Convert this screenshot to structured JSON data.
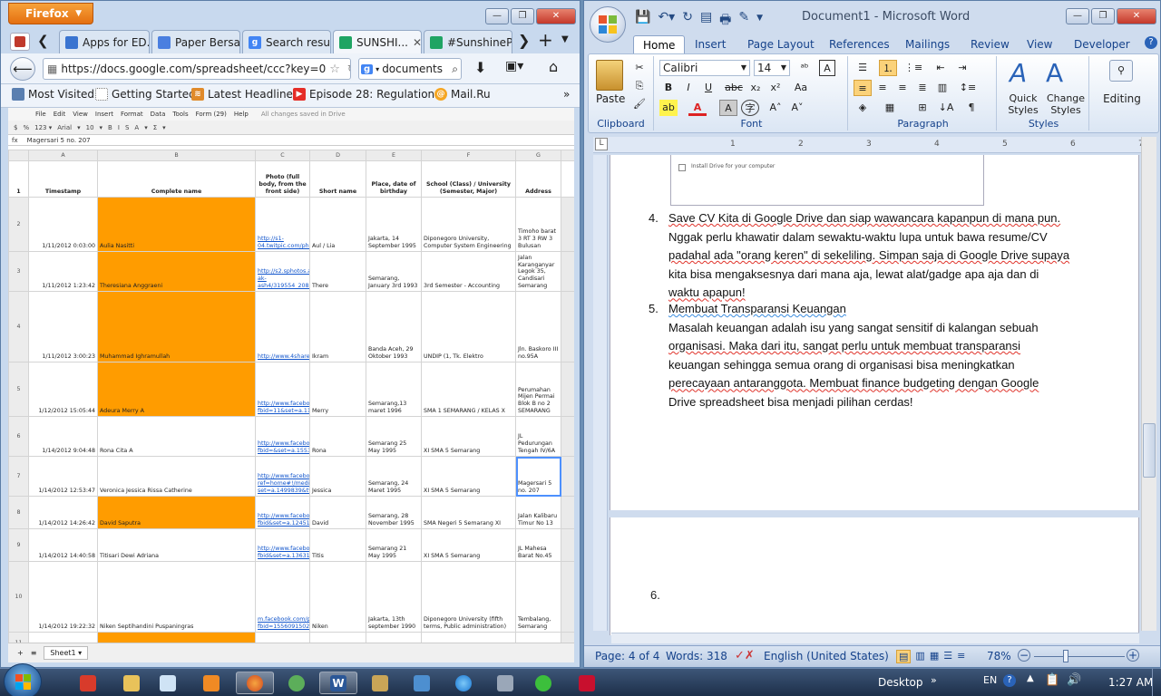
{
  "firefox": {
    "menu_button": "Firefox",
    "tabs": [
      {
        "label": "Apps for ED...",
        "icon": "doc-icon",
        "color": "#3a74d0"
      },
      {
        "label": "Paper Bersa...",
        "icon": "docs-icon",
        "color": "#4a7fe0"
      },
      {
        "label": "Search resul...",
        "icon": "google-icon",
        "color": "#4285f4"
      },
      {
        "label": "SUNSHI...",
        "icon": "drive-icon",
        "color": "#1fa463",
        "active": true
      },
      {
        "label": "#SunshineP...",
        "icon": "drive-icon",
        "color": "#1fa463"
      }
    ],
    "url": "https://docs.google.com/spreadsheet/ccc?key=0",
    "search_value": "documents",
    "bookmarks": [
      "Most Visited",
      "Getting Started",
      "Latest Headlines",
      "Episode 28: Regulation...",
      "Mail.Ru"
    ]
  },
  "sheet": {
    "menu": [
      "File",
      "Edit",
      "View",
      "Insert",
      "Format",
      "Data",
      "Tools",
      "Form (29)",
      "Help",
      "All changes saved in Drive"
    ],
    "toolbar": [
      "$",
      "%",
      "123 ▾",
      "Arial",
      "▾",
      "10",
      "▾",
      "B",
      "I",
      "S",
      "A",
      "▾",
      "Σ",
      "▾"
    ],
    "formula_label": "fx",
    "formula_value": "Magersari 5 no. 207",
    "columns": [
      "A",
      "B",
      "C",
      "D",
      "E",
      "F",
      "G"
    ],
    "headers": [
      "Timestamp",
      "Complete name",
      "Photo (full body, from the front side)",
      "Short name",
      "Place, date of birthday",
      "School (Class) / University (Semester, Major)",
      "Address"
    ],
    "rows": [
      {
        "n": "2",
        "ts": "1/11/2012 0:03:00",
        "name": "Aulia Nasitti",
        "photo": "http://s1-04.twitpic.com/photos/full/493254695.jpg",
        "short": "Aul / Lia",
        "birth": "Jakarta, 14 September 1995",
        "school": "Diponegoro University, Computer System Engineering",
        "addr": "Timoho barat 3 RT 3 RW 3 Bulusan",
        "org": true
      },
      {
        "n": "3",
        "ts": "1/11/2012 1:23:42",
        "name": "Theresiana Anggraeni",
        "photo": "http://s2.sphotos.ak.fbcdn.net/hphotos-ak-ash4/319554_20837405",
        "short": "There",
        "birth": "Semarang, January 3rd 1993",
        "school": "3rd Semester - Accounting",
        "addr": "Jalan Karanganyar Legok 35, Candisari Semarang",
        "org": true
      },
      {
        "n": "4",
        "ts": "1/11/2012 3:00:23",
        "name": "Muhammad Ighramullah",
        "photo": "http://www.4shared.com/photo/NAIWcou9/IMG_1132.html",
        "short": "Ikram",
        "birth": "Banda Aceh, 29 Oktober 1993",
        "school": "UNDIP (1, Tk. Elektro",
        "addr": "Jln. Baskoro III no.95A",
        "org": true
      },
      {
        "n": "5",
        "ts": "1/12/2012 15:05:44",
        "name": "Adeura Merry A",
        "photo": "http://www.facebook.com/photo.php?fbid=11&set=a.1155057510&type=3",
        "short": "Merry",
        "birth": "Semarang,13 maret 1996",
        "school": "SMA 1 SEMARANG / KELAS X",
        "addr": "Perumahan Mijen Permai Blok B no 2 SEMARANG",
        "org": true
      },
      {
        "n": "6",
        "ts": "1/14/2012 9:04:48",
        "name": "Rona Cita A",
        "photo": "http://www.facebook.com/#!/photo.php?fbid=&set=a.1553221344&type=3&theater",
        "short": "Rona",
        "birth": "Semarang 25 May 1995",
        "school": "XI SMA 5 Semarang",
        "addr": "JL Pedurungan Tengah IV/6A",
        "org": false
      },
      {
        "n": "7",
        "ts": "1/14/2012 12:53:47",
        "name": "Veronica Jessica Rissa Catherine",
        "photo": "http://www.facebook.com/?ref=home#!/media/set/?set=a.1499839&type=1",
        "short": "Jessica",
        "birth": "Semarang, 24 Maret 1995",
        "school": "XI SMA 5 Semarang",
        "addr": "Magersari 5 no. 207",
        "org": false
      },
      {
        "n": "8",
        "ts": "1/14/2012 14:26:42",
        "name": "David Saputra",
        "photo": "http://www.facebook.com/#!/photo.php?fbid&set=a.1245195179&type=3&theater",
        "short": "David",
        "birth": "Semarang, 28 November 1995",
        "school": "SMA Negeri 5 Semarang XI",
        "addr": "Jalan Kalibaru Timur No 13",
        "org": true
      },
      {
        "n": "9",
        "ts": "1/14/2012 14:40:58",
        "name": "Titisari Dewi Adriana",
        "photo": "http://www.facebook.com/#!/photo.php?fbid&set=a.1363122213&type=3&theater",
        "short": "Titis",
        "birth": "Semarang 21 May 1995",
        "school": "XI SMA 5 Semarang",
        "addr": "JL Mahesa Barat No.45",
        "org": false
      },
      {
        "n": "10",
        "ts": "1/14/2012 19:22:32",
        "name": "Niken Septihandini Puspaningras",
        "photo": "m.facebook.com/photo.php?fbid=15560915025&set=a.1555875152&refid=0",
        "short": "Niken",
        "birth": "Jakarta, 13th september 1990",
        "school": "Diponegoro University (fifth terms, Public administration)",
        "addr": "Tembalang, Semarang",
        "org": false
      },
      {
        "n": "11",
        "ts": "",
        "name": "",
        "photo": "http://www.faceboo",
        "short": "",
        "birth": "",
        "school": "",
        "addr": "",
        "org": true
      }
    ],
    "sheet_tab": "Sheet1"
  },
  "word": {
    "title": "Document1 - Microsoft Word",
    "ribbon_tabs": [
      "Home",
      "Insert",
      "Page Layout",
      "References",
      "Mailings",
      "Review",
      "View",
      "Developer"
    ],
    "font_name": "Calibri",
    "font_size": "14",
    "groups": [
      "Clipboard",
      "Font",
      "Paragraph",
      "Styles",
      "Editing"
    ],
    "paste_label": "Paste",
    "quick_styles": "Quick Styles",
    "change_styles": "Change Styles",
    "editing_label": "Editing",
    "embedded_caption": "Install Drive for your computer",
    "items": [
      {
        "num": "4.",
        "lines": [
          "Save CV Kita di Google Drive dan siap wawancara kapanpun di mana pun.",
          "Nggak perlu khawatir dalam sewaktu-waktu lupa untuk bawa resume/CV",
          "padahal ada \"orang keren\" di sekeliling. Simpan saja di Google Drive supaya",
          "kita bisa mengaksesnya dari mana aja, lewat alat/gadge apa aja dan di",
          "waktu apapun!"
        ]
      },
      {
        "num": "5.",
        "lines": [
          "Membuat Transparansi Keuangan",
          "Masalah keuangan adalah isu yang sangat sensitif di kalangan sebuah",
          "organisasi. Maka dari itu, sangat perlu untuk membuat transparansi",
          "keuangan sehingga semua orang di organisasi bisa meningkatkan",
          "perecayaan antaranggota. Membuat finance budgeting dengan Google",
          "Drive spreadsheet bisa menjadi pilihan cerdas!"
        ]
      }
    ],
    "item6": "6.",
    "status": {
      "page": "Page: 4 of 4",
      "words": "Words: 318",
      "lang": "English (United States)",
      "zoom": "78%"
    }
  },
  "taskbar": {
    "desktop": "Desktop",
    "lang": "EN",
    "time": "1:27 AM"
  }
}
